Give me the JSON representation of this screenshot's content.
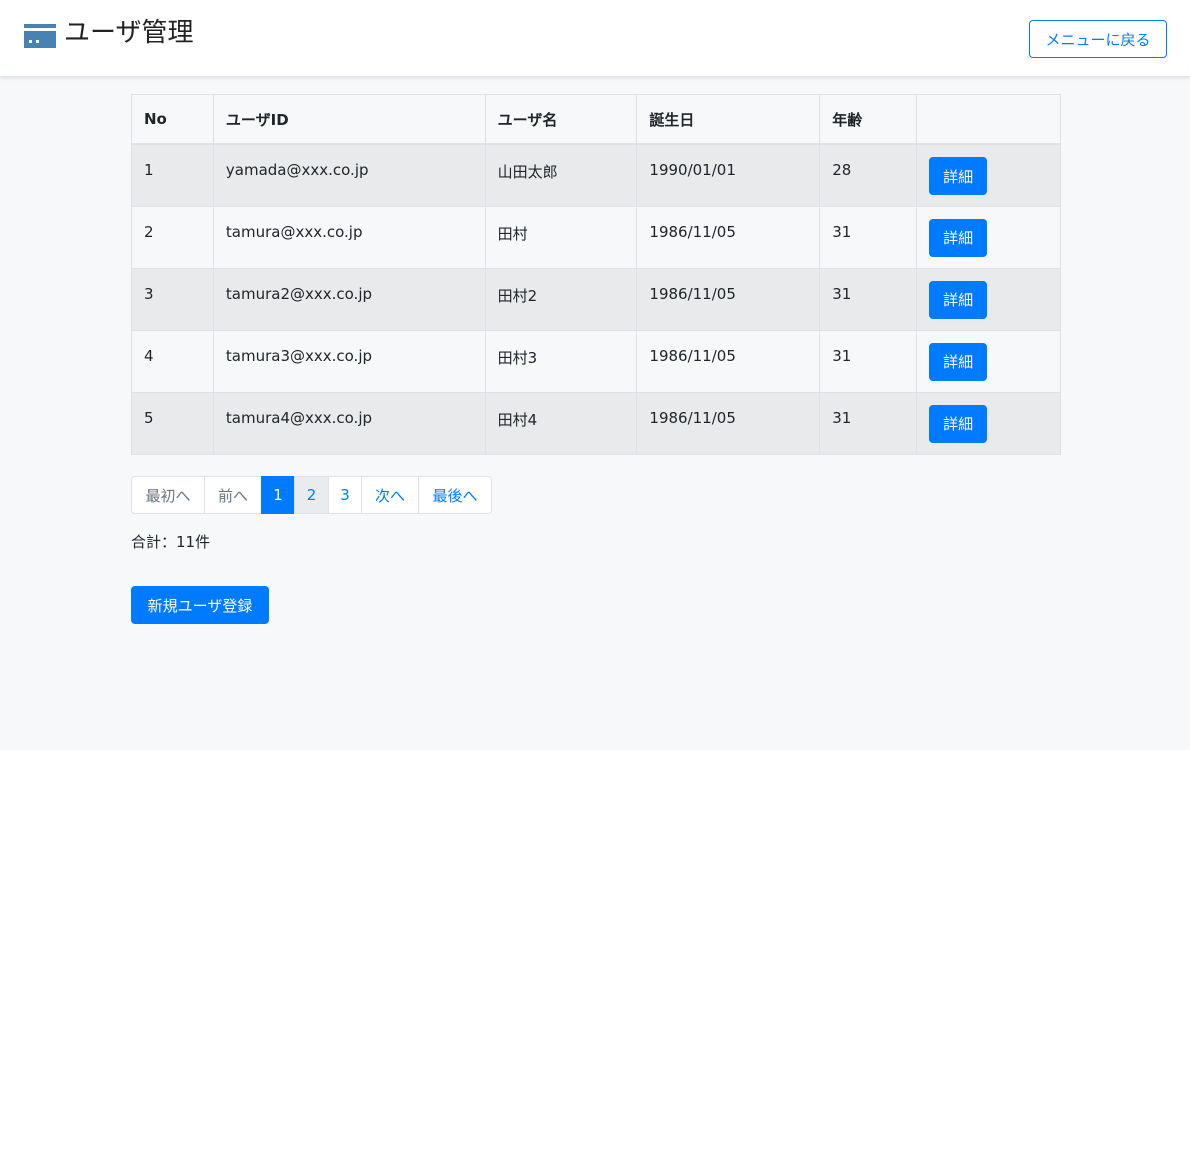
{
  "header": {
    "title": "ユーザ管理",
    "icon": "window-icon",
    "back_label": "メニューに戻る"
  },
  "colors": {
    "primary": "#007bff",
    "icon": "#4682b4"
  },
  "table": {
    "columns": [
      "No",
      "ユーザID",
      "ユーザ名",
      "誕生日",
      "年齢",
      ""
    ],
    "rows": [
      {
        "no": "1",
        "user_id": "yamada@xxx.co.jp",
        "name": "山田太郎",
        "birthday": "1990/01/01",
        "age": "28",
        "action": "詳細"
      },
      {
        "no": "2",
        "user_id": "tamura@xxx.co.jp",
        "name": "田村",
        "birthday": "1986/11/05",
        "age": "31",
        "action": "詳細"
      },
      {
        "no": "3",
        "user_id": "tamura2@xxx.co.jp",
        "name": "田村2",
        "birthday": "1986/11/05",
        "age": "31",
        "action": "詳細"
      },
      {
        "no": "4",
        "user_id": "tamura3@xxx.co.jp",
        "name": "田村3",
        "birthday": "1986/11/05",
        "age": "31",
        "action": "詳細"
      },
      {
        "no": "5",
        "user_id": "tamura4@xxx.co.jp",
        "name": "田村4",
        "birthday": "1986/11/05",
        "age": "31",
        "action": "詳細"
      }
    ]
  },
  "pagination": {
    "first": "最初へ",
    "prev": "前へ",
    "pages": [
      "1",
      "2",
      "3"
    ],
    "current": "1",
    "next": "次へ",
    "last": "最後へ"
  },
  "total": "合計：11件",
  "new_user_label": "新規ユーザ登録"
}
